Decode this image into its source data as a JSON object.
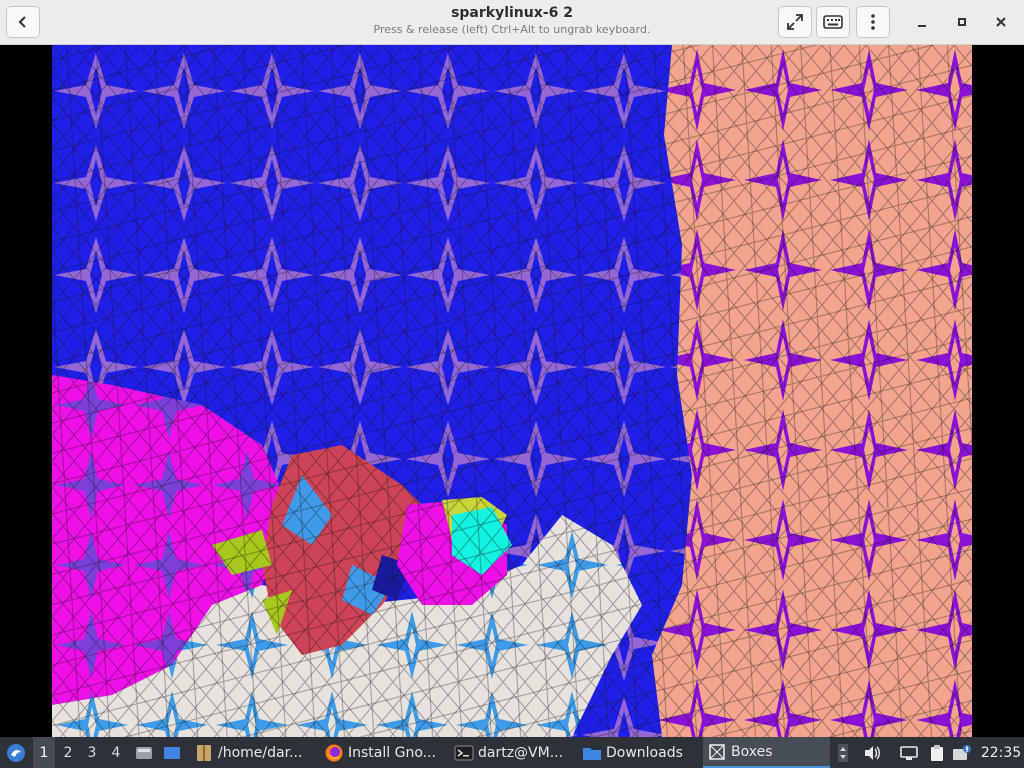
{
  "window": {
    "title": "sparkylinux-6 2",
    "subtitle": "Press & release (left) Ctrl+Alt to ungrab keyboard."
  },
  "header_buttons": {
    "back": "chevron-left-icon",
    "fullscreen": "fullscreen-icon",
    "keyboard": "keyboard-icon",
    "menu": "kebab-menu-icon",
    "minimize": "minimize-icon",
    "maximize": "maximize-icon",
    "close": "close-icon"
  },
  "taskbar": {
    "workspaces": [
      "1",
      "2",
      "3",
      "4"
    ],
    "active_workspace": "1",
    "tasks": [
      {
        "label": "/home/dar...",
        "icon": "archive-folder-icon"
      },
      {
        "label": "Install Gno...",
        "icon": "firefox-icon"
      },
      {
        "label": "dartz@VM...",
        "icon": "terminal-icon"
      },
      {
        "label": "Downloads",
        "icon": "folder-icon"
      },
      {
        "label": "Boxes",
        "icon": "boxes-icon",
        "active": true
      }
    ],
    "clock": "22:35"
  },
  "colors": {
    "header_bg": "#ececec",
    "taskbar_bg": "#2d3238",
    "tile_blue": "#1f1fe6",
    "tile_lavender": "#9467d4",
    "tile_peach": "#f2a58c",
    "tile_violet": "#8a12d6",
    "tile_magenta": "#ee10e6",
    "tile_crimson": "#cc4455",
    "tile_lightblue": "#3f9be8",
    "tile_offwhite": "#e8e2dc",
    "tile_cyan": "#14f2e0",
    "tile_yellowgreen": "#c8d63a"
  }
}
